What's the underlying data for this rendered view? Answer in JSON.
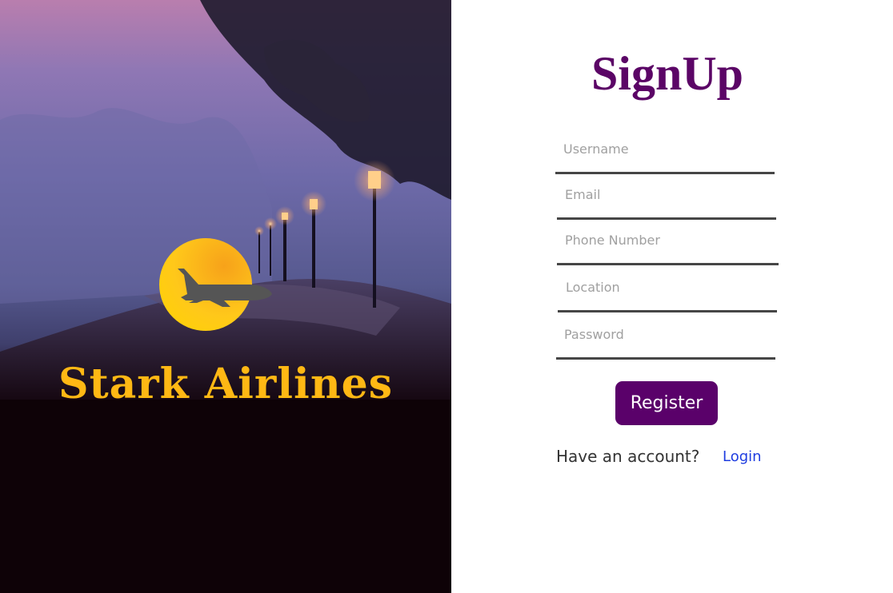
{
  "hero": {
    "brand_name": "Stark Airlines",
    "logo_icon": "airplane-icon"
  },
  "form": {
    "title": "SignUp",
    "fields": [
      {
        "name": "username",
        "placeholder": "Username",
        "value": ""
      },
      {
        "name": "email",
        "placeholder": "Email",
        "value": ""
      },
      {
        "name": "phone",
        "placeholder": "Phone Number",
        "value": ""
      },
      {
        "name": "location",
        "placeholder": "Location",
        "value": ""
      },
      {
        "name": "password",
        "placeholder": "Password",
        "value": ""
      }
    ],
    "register_label": "Register",
    "have_account_text": "Have an account?",
    "login_label": "Login"
  },
  "colors": {
    "brand_purple": "#5a016a",
    "brand_gold": "#ffb814",
    "link_blue": "#1f3de0"
  }
}
